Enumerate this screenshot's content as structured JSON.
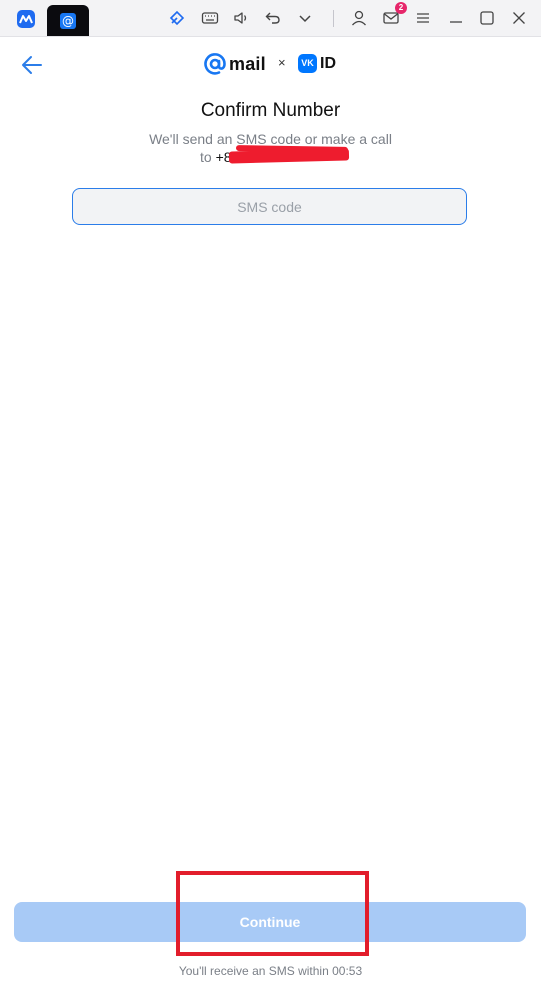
{
  "titlebar": {
    "app_icon": "multitask-app-icon",
    "tab_icon_glyph": "@",
    "icons": [
      "pin-icon",
      "keyboard-icon",
      "volume-icon",
      "undo-icon",
      "chevron-down-icon",
      "user-icon",
      "mail-icon",
      "menu-icon",
      "minimize-icon",
      "maximize-icon",
      "close-icon"
    ],
    "mail_badge": "2"
  },
  "header": {
    "back_icon": "arrow-left-icon",
    "brand_mail": "mail",
    "brand_separator": "×",
    "vk_mark": "VK",
    "brand_id": "ID"
  },
  "main": {
    "title": "Confirm Number",
    "subtitle_line1": "We'll send an SMS code or make a call",
    "subtitle_to": "to",
    "phone_prefix": "+8",
    "sms_input": {
      "placeholder": "SMS code",
      "value": ""
    }
  },
  "footer": {
    "continue_label": "Continue",
    "timer_text": "You'll receive an SMS within 00:53"
  },
  "colors": {
    "accent": "#2b7de9",
    "button_disabled": "#a8caf6",
    "redaction": "#ee1c2e",
    "badge": "#e6266a"
  }
}
